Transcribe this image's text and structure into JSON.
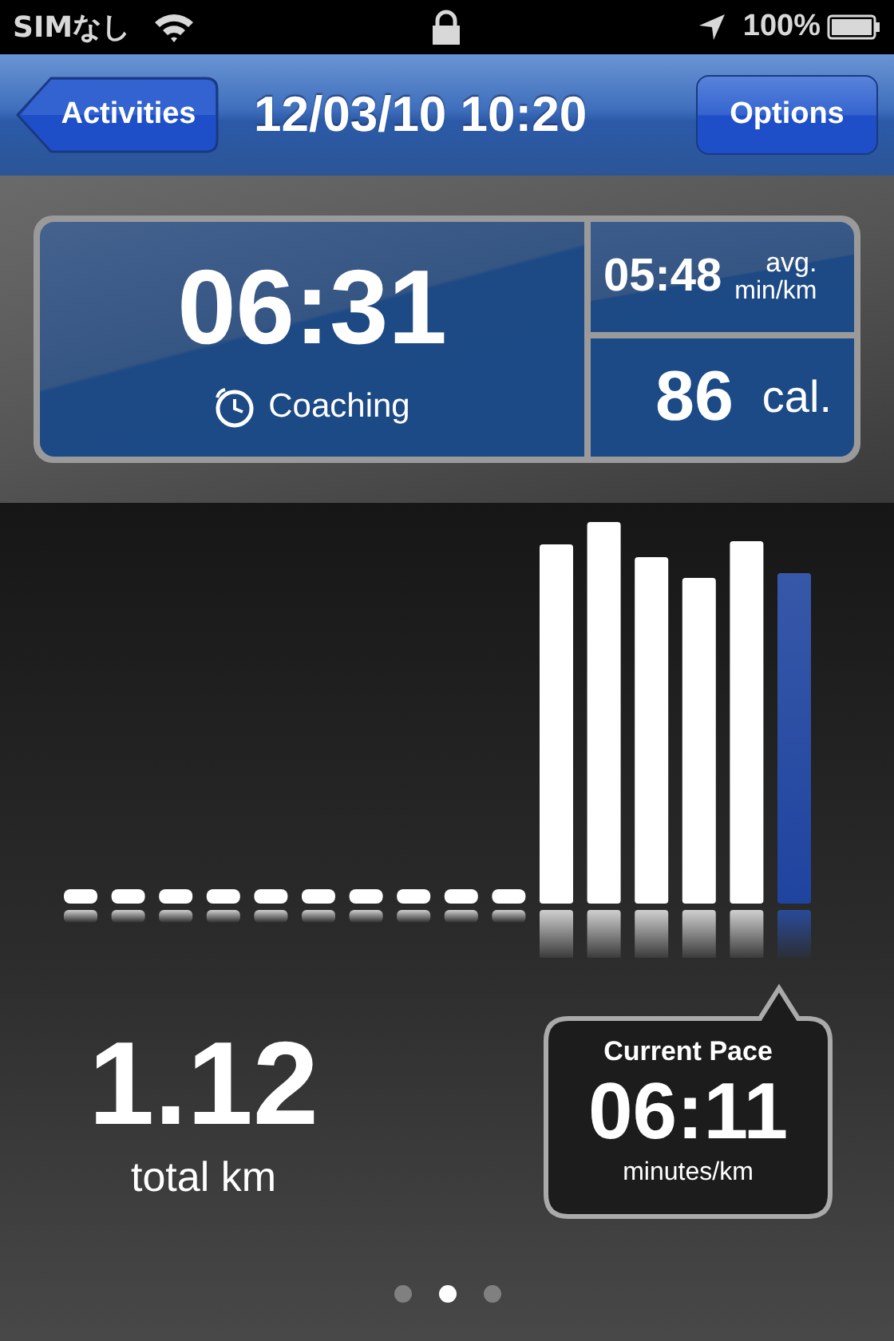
{
  "status_bar": {
    "carrier": "SIMなし",
    "battery": "100%"
  },
  "nav_bar": {
    "back_button": "Activities",
    "title": "12/03/10 10:20",
    "options_button": "Options"
  },
  "stats": {
    "duration": "06:31",
    "coaching": "Coaching",
    "avg_pace": "05:48",
    "avg_label": "avg.",
    "avg_unit": "min/km",
    "calories": "86",
    "calories_unit": "cal."
  },
  "distance": {
    "value": "1.12",
    "label": "total km"
  },
  "current_pace": {
    "title": "Current Pace",
    "value": "06:11",
    "unit": "minutes/km"
  },
  "page_indicator": [
    {
      "selected": false
    },
    {
      "selected": true
    },
    {
      "selected": false
    }
  ]
}
